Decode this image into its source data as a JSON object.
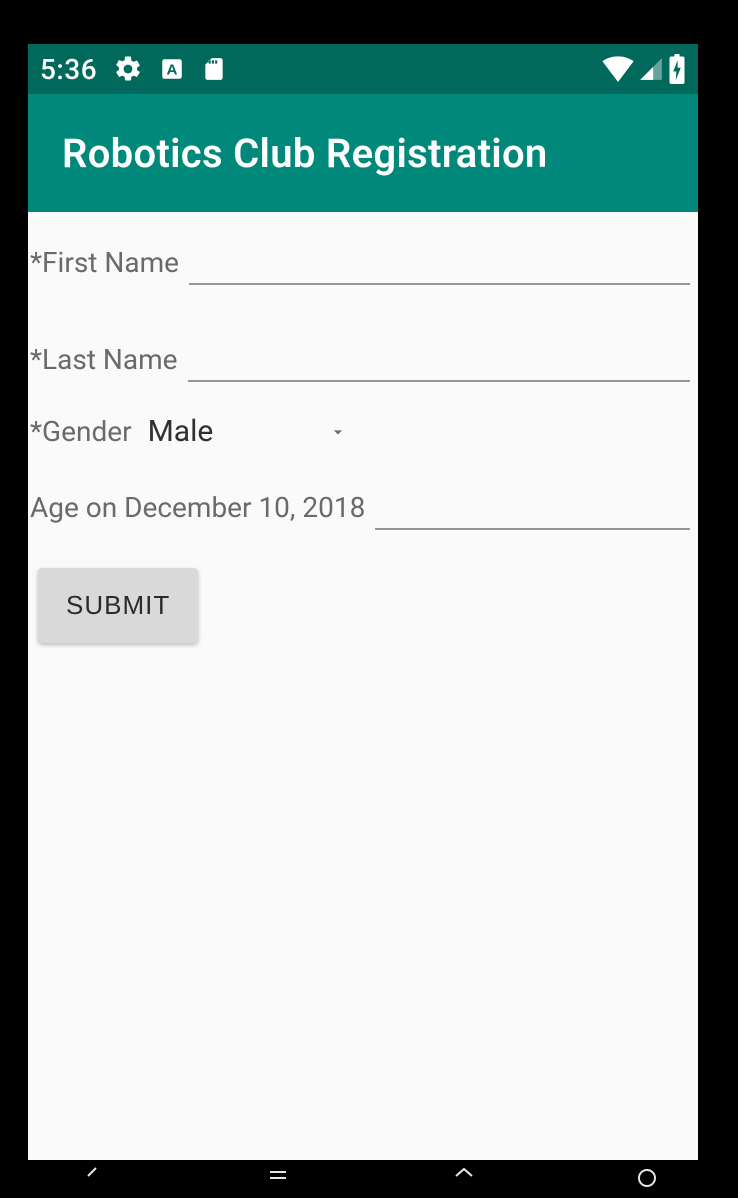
{
  "status": {
    "time": "5:36"
  },
  "app": {
    "title": "Robotics Club Registration"
  },
  "form": {
    "first_name_label": "*First Name",
    "first_name_value": "",
    "last_name_label": "*Last Name",
    "last_name_value": "",
    "gender_label": "*Gender",
    "gender_value": "Male",
    "age_label": "Age on December 10, 2018",
    "age_value": "",
    "submit_label": "SUBMIT"
  }
}
